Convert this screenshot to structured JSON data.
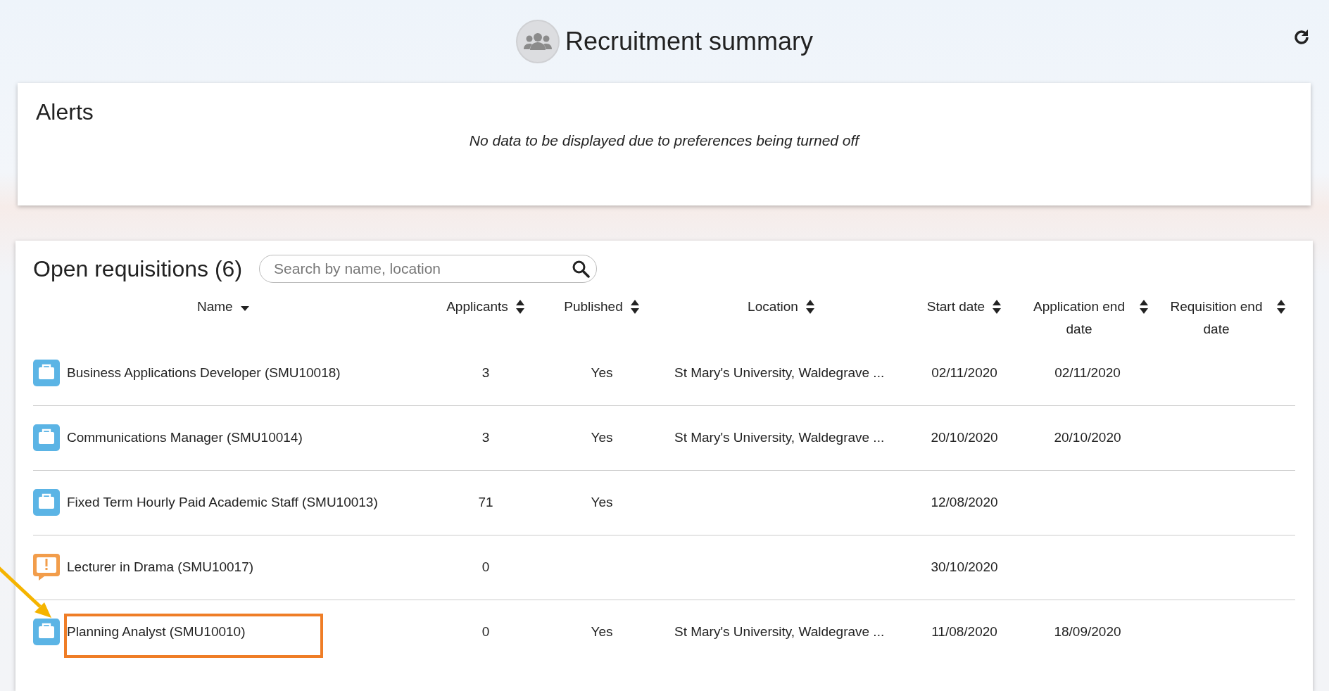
{
  "header": {
    "title": "Recruitment summary"
  },
  "alerts": {
    "title": "Alerts",
    "message": "No data to be displayed due to preferences being turned off"
  },
  "requisitions": {
    "title": "Open requisitions (6)",
    "search": {
      "placeholder": "Search by name, location"
    },
    "columns": [
      {
        "label": "Name",
        "sorted": true
      },
      {
        "label": "Applicants",
        "sorted": false
      },
      {
        "label": "Published",
        "sorted": false
      },
      {
        "label": "Location",
        "sorted": false
      },
      {
        "label": "Start date",
        "sorted": false
      },
      {
        "label": "Application end date",
        "sorted": false
      },
      {
        "label": "Requisition end date",
        "sorted": false
      }
    ],
    "rows": [
      {
        "kind": "open",
        "highlighted": false,
        "name": "Business Applications Developer (SMU10018)",
        "applicants": "3",
        "published": "Yes",
        "location": "St Mary's University, Waldegrave ...",
        "start_date": "02/11/2020",
        "application_end_date": "02/11/2020"
      },
      {
        "kind": "open",
        "highlighted": false,
        "name": "Communications Manager (SMU10014)",
        "applicants": "3",
        "published": "Yes",
        "location": "St Mary's University, Waldegrave ...",
        "start_date": "20/10/2020",
        "application_end_date": "20/10/2020"
      },
      {
        "kind": "open",
        "highlighted": false,
        "name": "Fixed Term Hourly Paid Academic Staff (SMU10013)",
        "applicants": "71",
        "published": "Yes",
        "start_date": "12/08/2020"
      },
      {
        "kind": "alert",
        "highlighted": false,
        "name": "Lecturer in Drama (SMU10017)",
        "applicants": "0",
        "start_date": "30/10/2020"
      },
      {
        "kind": "open",
        "highlighted": true,
        "name": "Planning Analyst (SMU10010)",
        "applicants": "0",
        "published": "Yes",
        "location": "St Mary's University, Waldegrave ...",
        "start_date": "11/08/2020",
        "application_end_date": "18/09/2020"
      }
    ]
  }
}
